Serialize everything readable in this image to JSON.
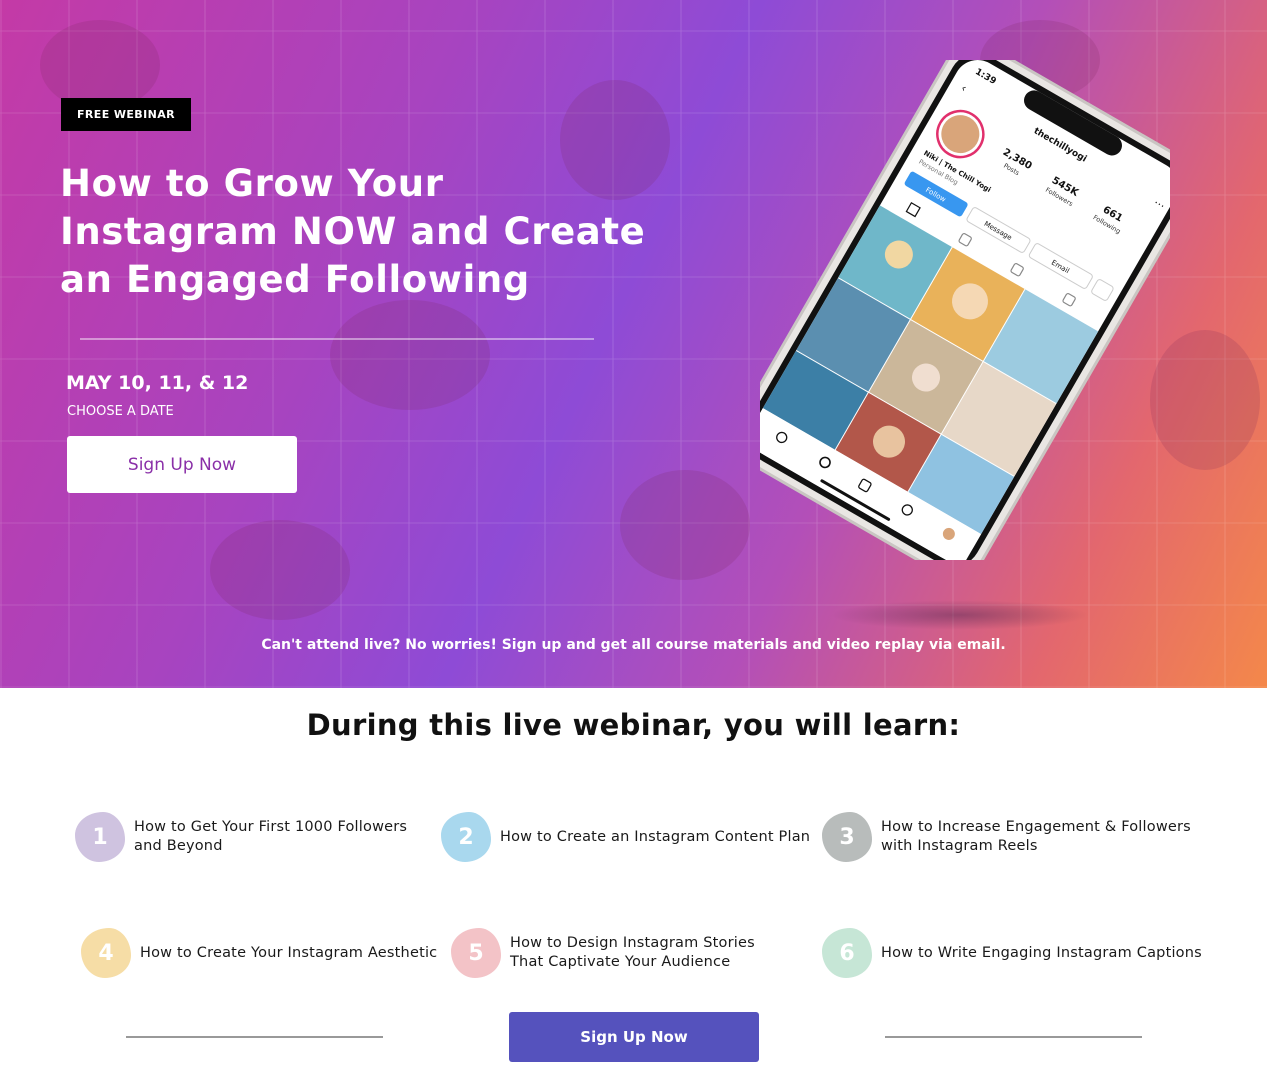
{
  "hero": {
    "badge": "FREE WEBINAR",
    "title": "How to Grow Your Instagram NOW and Create an Engaged Following",
    "date": "MAY 10, 11, & 12",
    "date_sub": "CHOOSE A DATE",
    "cta": "Sign Up Now",
    "note": "Can't attend live? No worries! Sign up and get all course materials and video replay via email."
  },
  "phone": {
    "time": "1:39",
    "username": "thechillyogi",
    "stats": [
      {
        "value": "2,380",
        "label": "Posts"
      },
      {
        "value": "545K",
        "label": "Followers"
      },
      {
        "value": "661",
        "label": "Following"
      }
    ],
    "name": "Niki | The Chill Yogi",
    "bio": "Personal Blog",
    "buttons": [
      "Follow",
      "Message",
      "Email"
    ]
  },
  "learn": {
    "title": "During this live webinar, you will learn:",
    "items": [
      {
        "number": "1",
        "text": "How to Get Your First 1000 Followers and Beyond",
        "color": "#cfc3e0"
      },
      {
        "number": "2",
        "text": "How to Create an Instagram Content Plan",
        "color": "#a9d8ee"
      },
      {
        "number": "3",
        "text": "How to Increase Engagement & Followers with Instagram Reels",
        "color": "#b8bcbb"
      },
      {
        "number": "4",
        "text": "How to Create Your Instagram Aesthetic",
        "color": "#f6dda6"
      },
      {
        "number": "5",
        "text": "How to Design Instagram Stories That Captivate Your Audience",
        "color": "#f3c3c7"
      },
      {
        "number": "6",
        "text": "How to Write Engaging Instagram Captions",
        "color": "#c6e6d6"
      }
    ],
    "cta": "Sign Up Now"
  },
  "colors": {
    "hero_cta_text": "#8a2fa8",
    "bottom_cta_bg": "#5552bd"
  }
}
